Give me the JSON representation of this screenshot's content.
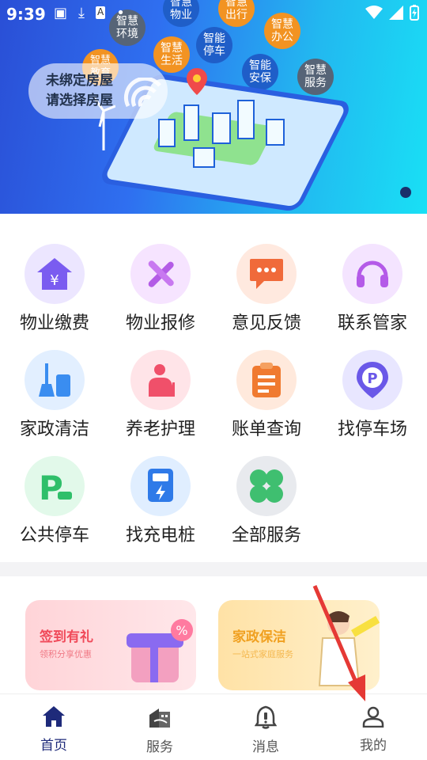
{
  "status": {
    "time": "9:39"
  },
  "hero": {
    "bind_line1": "未绑定房屋",
    "bind_line2": "请选择房屋",
    "bubbles": {
      "env": "智慧\n环境",
      "property": "智慧\n物业",
      "travel": "智慧\n出行",
      "office": "智慧\n办公",
      "parking": "智能\n停车",
      "life": "智慧\n生活",
      "security": "智能\n安保",
      "service": "智慧\n服务",
      "edu": "智慧\n教育"
    }
  },
  "services": [
    {
      "label": "物业缴费",
      "icon": "house-yen-icon",
      "color": "#7a5cf0"
    },
    {
      "label": "物业报修",
      "icon": "tools-icon",
      "color": "#b35ce6"
    },
    {
      "label": "意见反馈",
      "icon": "chat-bubble-icon",
      "color": "#f06a3a"
    },
    {
      "label": "联系管家",
      "icon": "headset-icon",
      "color": "#b45ae8"
    },
    {
      "label": "家政清洁",
      "icon": "cleaning-icon",
      "color": "#3a8df0"
    },
    {
      "label": "养老护理",
      "icon": "elder-care-icon",
      "color": "#f0506a"
    },
    {
      "label": "账单查询",
      "icon": "clipboard-icon",
      "color": "#f07a30"
    },
    {
      "label": "找停车场",
      "icon": "parking-pin-icon",
      "color": "#6a58e8"
    },
    {
      "label": "公共停车",
      "icon": "public-parking-icon",
      "color": "#2fbf6a"
    },
    {
      "label": "找充电桩",
      "icon": "charging-pile-icon",
      "color": "#2f7ae8"
    },
    {
      "label": "全部服务",
      "icon": "all-services-icon",
      "color": "#3fbf70"
    }
  ],
  "promos": [
    {
      "title": "签到有礼",
      "sub": "领积分享优惠",
      "color": "#f04a5a"
    },
    {
      "title": "家政保洁",
      "sub": "一站式家庭服务",
      "color": "#f0a020"
    }
  ],
  "nav": [
    {
      "label": "首页",
      "icon": "home-icon"
    },
    {
      "label": "服务",
      "icon": "building-icon"
    },
    {
      "label": "消息",
      "icon": "bell-icon"
    },
    {
      "label": "我的",
      "icon": "user-icon"
    }
  ]
}
